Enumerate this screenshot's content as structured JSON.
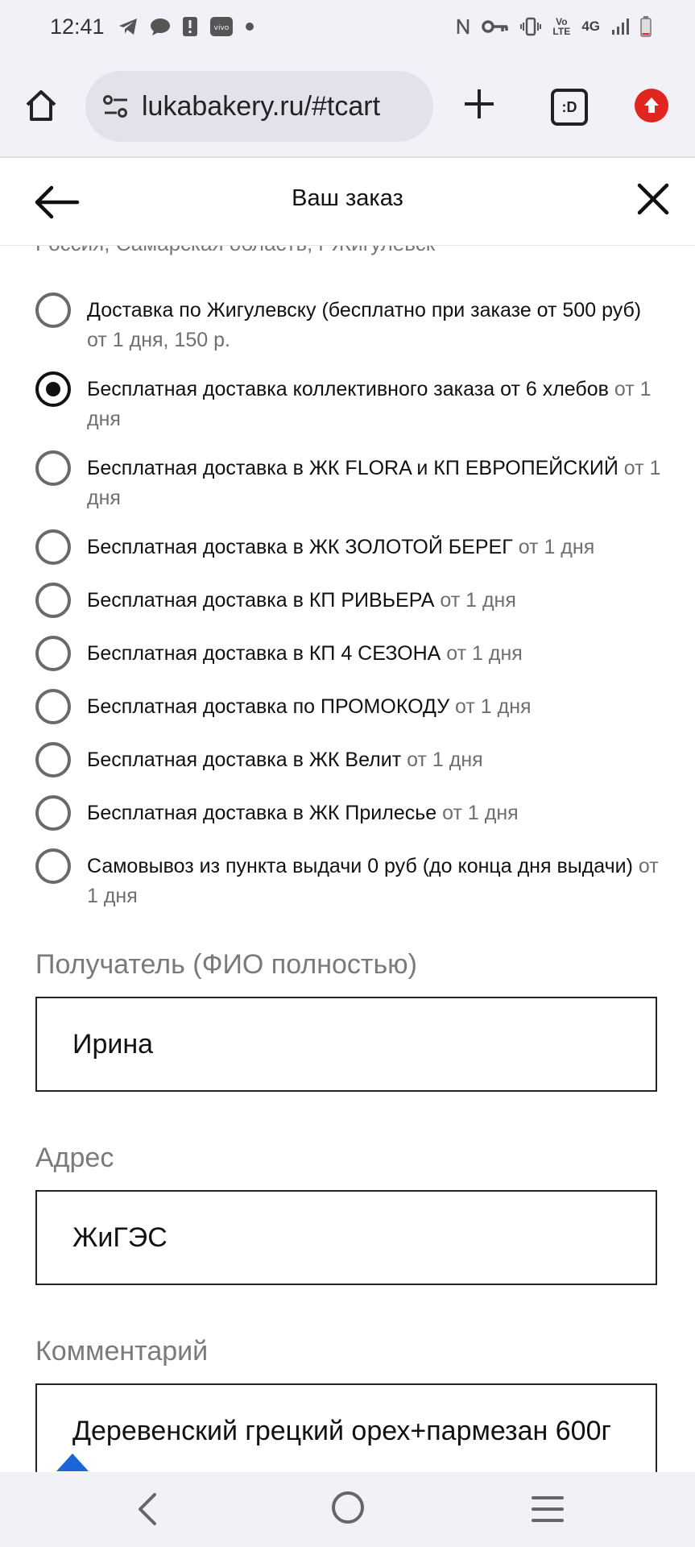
{
  "status_bar": {
    "time": "12:41",
    "network": "4G",
    "volte": "Vo LTE",
    "left_icons": [
      "telegram-icon",
      "chat-bubble-icon",
      "alert-icon",
      "vivo-icon",
      "dot-icon"
    ],
    "right_icons": [
      "nfc-icon",
      "key-icon",
      "vibrate-icon",
      "signal-icon",
      "battery-icon"
    ]
  },
  "browser": {
    "url": "lukabakery.ru/#tcart",
    "tabs_label": ":D"
  },
  "header": {
    "title": "Ваш заказ"
  },
  "address_line_cut": "Россия, Самарская область, г Жигулевск",
  "delivery_options": [
    {
      "label": "Доставка по Жигулевску (бесплатно при заказе от 500 руб)",
      "days": "от 1 дня, 150 р.",
      "selected": false
    },
    {
      "label": "Бесплатная доставка коллективного заказа от 6 хлебов",
      "days": "от 1 дня",
      "selected": true
    },
    {
      "label": "Бесплатная доставка в ЖК FLORA и КП ЕВРОПЕЙСКИЙ",
      "days": "от 1 дня",
      "selected": false
    },
    {
      "label": "Бесплатная доставка в ЖК ЗОЛОТОЙ БЕРЕГ",
      "days": "от 1 дня",
      "selected": false
    },
    {
      "label": "Бесплатная доставка в КП РИВЬЕРА",
      "days": "от 1 дня",
      "selected": false
    },
    {
      "label": "Бесплатная доставка в КП 4 СЕЗОНА",
      "days": "от 1 дня",
      "selected": false
    },
    {
      "label": "Бесплатная доставка по ПРОМОКОДУ",
      "days": "от 1 дня",
      "selected": false
    },
    {
      "label": "Бесплатная доставка в ЖК Велит",
      "days": "от 1 дня",
      "selected": false
    },
    {
      "label": "Бесплатная доставка в ЖК Прилесье",
      "days": "от 1 дня",
      "selected": false
    },
    {
      "label": "Самовывоз из пункта выдачи 0 руб (до конца дня выдачи)",
      "days": "от 1 дня",
      "selected": false
    }
  ],
  "form": {
    "recipient_label": "Получатель (ФИО полностью)",
    "recipient_value": "Ирина",
    "address_label": "Адрес",
    "address_value": "ЖиГЭС",
    "comment_label": "Комментарий",
    "comment_value": "Деревенский грецкий орех+пармезан 600г"
  },
  "colors": {
    "chrome_bg": "#f3f1f8",
    "url_pill": "#e4e1ea",
    "update_red": "#e0261f",
    "scroll_arrow_blue": "#1a66d6"
  }
}
